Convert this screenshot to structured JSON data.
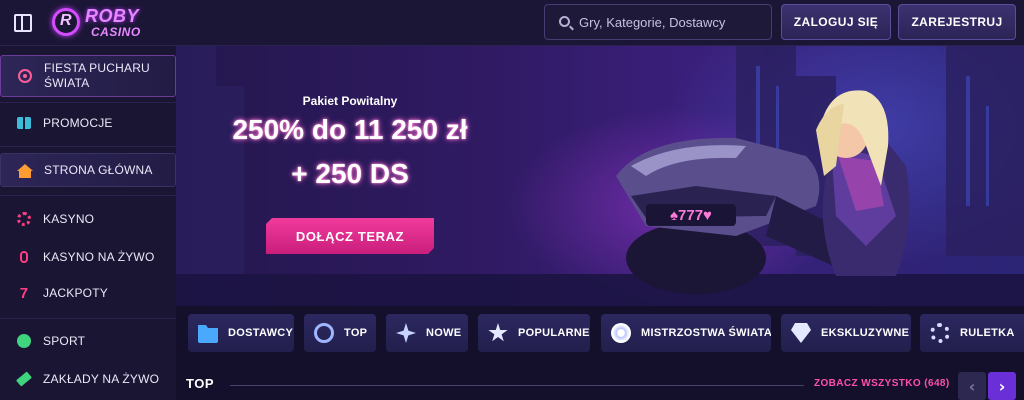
{
  "header": {
    "logo_top": "ROBY",
    "logo_bottom": "CASINO",
    "search_placeholder": "Gry, Kategorie, Dostawcy",
    "login_label": "ZALOGUJ SIĘ",
    "register_label": "ZAREJESTRUJ"
  },
  "sidebar": {
    "items": [
      {
        "label": "FIESTA PUCHARU ŚWIATA",
        "icon": "football-icon"
      },
      {
        "label": "PROMOCJE",
        "icon": "gift-icon"
      },
      {
        "label": "STRONA GŁÓWNA",
        "icon": "home-icon"
      },
      {
        "label": "KASYNO",
        "icon": "casino-chip-icon"
      },
      {
        "label": "KASYNO NA ŻYWO",
        "icon": "microphone-icon"
      },
      {
        "label": "JACKPOTY",
        "icon": "seven-icon"
      },
      {
        "label": "SPORT",
        "icon": "sport-ball-icon"
      },
      {
        "label": "ZAKŁADY NA ŻYWO",
        "icon": "ticket-icon"
      }
    ]
  },
  "hero": {
    "subtitle": "Pakiet Powitalny",
    "line1": "250% do 11 250 zł",
    "line2": "+ 250 DS",
    "cta_label": "DOŁĄCZ TERAZ",
    "bike_plate": "♠777♥"
  },
  "categories": [
    {
      "label": "DOSTAWCY",
      "icon": "folder-icon"
    },
    {
      "label": "TOP",
      "icon": "medal-icon"
    },
    {
      "label": "NOWE",
      "icon": "sparkle-icon"
    },
    {
      "label": "POPULARNE",
      "icon": "star-icon"
    },
    {
      "label": "MISTRZOSTWA ŚWIATA",
      "icon": "soccer-ball-icon"
    },
    {
      "label": "EKSKLUZYWNE",
      "icon": "diamond-icon"
    },
    {
      "label": "RULETKA",
      "icon": "roulette-icon"
    }
  ],
  "section": {
    "title": "TOP",
    "see_all": "ZOBACZ WSZYSTKO (648)",
    "prev_arrow": "‹",
    "next_arrow": "›"
  },
  "colors": {
    "accent_pink": "#f13a9c",
    "accent_purple": "#6a2fd6",
    "background": "#13102a"
  }
}
